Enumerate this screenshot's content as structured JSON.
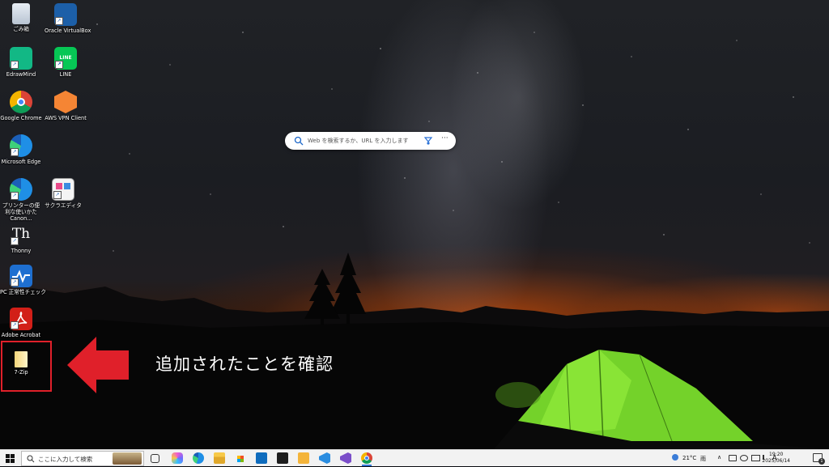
{
  "desktop": {
    "icons": [
      {
        "label": "ごみ箱",
        "icon": "recycle-bin-icon"
      },
      {
        "label": "Oracle VirtualBox",
        "icon": "virtualbox-icon"
      },
      {
        "label": "EdrawMind",
        "icon": "edrawmind-icon"
      },
      {
        "label": "LINE",
        "icon": "line-icon"
      },
      {
        "label": "Google Chrome",
        "icon": "chrome-icon"
      },
      {
        "label": "AWS VPN Client",
        "icon": "aws-vpn-icon"
      },
      {
        "label": "Microsoft Edge",
        "icon": "edge-icon"
      },
      {
        "label": "プリンターの便利な使いかた Canon...",
        "icon": "canon-guide-icon"
      },
      {
        "label": "サクラエディタ",
        "icon": "sakura-editor-icon"
      },
      {
        "label": "Thonny",
        "icon": "thonny-icon"
      },
      {
        "label": "PC 正常性チェック",
        "icon": "pc-health-check-icon"
      },
      {
        "label": "Adobe Acrobat",
        "icon": "adobe-acrobat-icon"
      },
      {
        "label": "7-Zip",
        "icon": "7zip-folder-icon"
      }
    ],
    "search": {
      "placeholder": "Web を検索するか、URL を入力します",
      "more": "···"
    },
    "annotation": "追加されたことを確認",
    "colors": {
      "annotation_red": "#e0202a",
      "tent_green": "#7fe02a"
    }
  },
  "taskbar": {
    "search_placeholder": "ここに入力して検索",
    "apps": [
      "task-view-icon",
      "copilot-icon",
      "edge-icon",
      "file-explorer-icon",
      "outlook-icon",
      "terminal-icon",
      "media-icon",
      "vscode-icon",
      "visual-studio-icon",
      "chrome-icon"
    ],
    "weather": "21°C",
    "weather_condition": "雨",
    "time": "19:20",
    "date": "2025/06/14",
    "ime": "A",
    "notification_count": "1"
  }
}
